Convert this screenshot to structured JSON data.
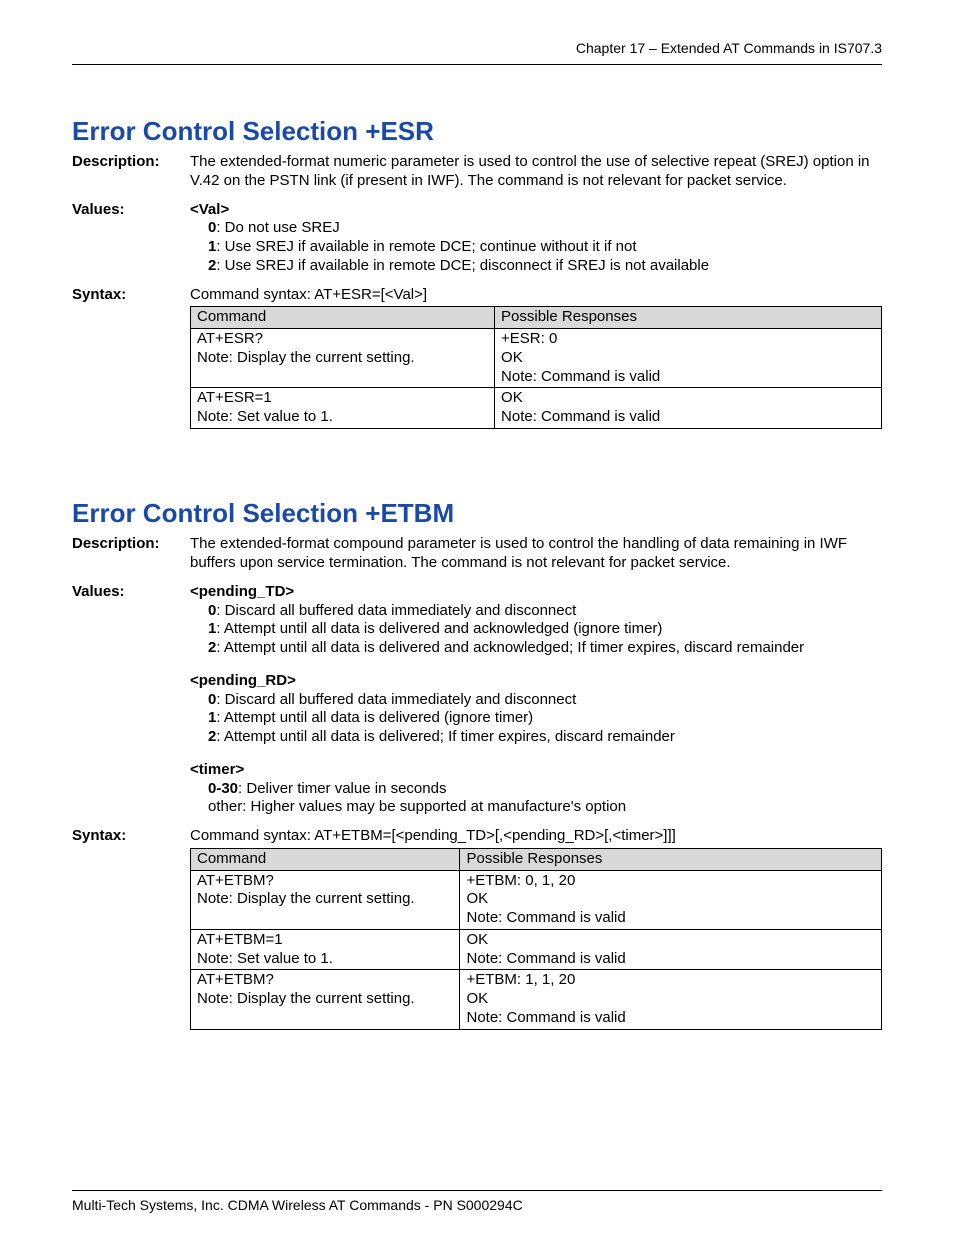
{
  "header": "Chapter 17 – Extended AT Commands in IS707.3",
  "footer": "Multi-Tech Systems, Inc. CDMA Wireless AT Commands - PN S000294C",
  "labels": {
    "description": "Description:",
    "values": "Values:",
    "syntax": "Syntax:"
  },
  "section1": {
    "title": "Error Control Selection  +ESR",
    "description": "The extended-format numeric parameter is used to control the use of selective repeat (SREJ) option in V.42 on the PSTN link (if present in IWF). The command is not relevant for packet service.",
    "values_param": "<Val>",
    "val0_k": "0",
    "val0_t": ": Do not use SREJ",
    "val1_k": "1",
    "val1_t": ": Use SREJ if available in remote DCE; continue without it if not",
    "val2_k": "2",
    "val2_t": ": Use SREJ if available in remote DCE; disconnect if SREJ is not available",
    "syntax_line": "Command syntax: AT+ESR=[<Val>]",
    "th1": "Command",
    "th2": "Possible Responses",
    "r1c1a": "AT+ESR?",
    "r1c1b": "Note: Display the current setting.",
    "r1c2a": "+ESR: 0",
    "r1c2b": "OK",
    "r1c2c": "Note: Command is valid",
    "r2c1a": "AT+ESR=1",
    "r2c1b": "Note: Set value to 1.",
    "r2c2a": "OK",
    "r2c2b": "Note: Command is valid"
  },
  "section2": {
    "title": "Error Control Selection  +ETBM",
    "description": "The extended-format compound parameter is used to control the handling of data remaining in IWF buffers upon service termination. The command is not relevant for packet service.",
    "p1_name": "<pending_TD>",
    "p1_0k": "0",
    "p1_0t": ": Discard all buffered data immediately and disconnect",
    "p1_1k": "1",
    "p1_1t": ": Attempt until all data is delivered and acknowledged (ignore timer)",
    "p1_2k": "2",
    "p1_2t": ": Attempt until all data is delivered and acknowledged; If timer expires, discard remainder",
    "p2_name": "<pending_RD>",
    "p2_0k": "0",
    "p2_0t": ": Discard all buffered data immediately and disconnect",
    "p2_1k": "1",
    "p2_1t": ": Attempt until all data is delivered (ignore timer)",
    "p2_2k": "2",
    "p2_2t": ": Attempt until all data is delivered; If timer expires, discard remainder",
    "p3_name": "<timer>",
    "p3_0k": "0-30",
    "p3_0t": ": Deliver timer value in seconds",
    "p3_1t": "other: Higher values may be supported at manufacture's option",
    "syntax_line": "Command syntax: AT+ETBM=[<pending_TD>[,<pending_RD>[,<timer>]]]",
    "th1": "Command",
    "th2": "Possible Responses",
    "r1c1a": "AT+ETBM?",
    "r1c1b": "Note: Display the current setting.",
    "r1c2a": "+ETBM: 0, 1, 20",
    "r1c2b": "OK",
    "r1c2c": "Note: Command is valid",
    "r2c1a": "AT+ETBM=1",
    "r2c1b": "Note: Set value to 1.",
    "r2c2a": "OK",
    "r2c2b": "Note: Command is valid",
    "r3c1a": "AT+ETBM?",
    "r3c1b": "Note: Display the current setting.",
    "r3c2a": "+ETBM: 1, 1, 20",
    "r3c2b": "OK",
    "r3c2c": "Note: Command is valid"
  }
}
